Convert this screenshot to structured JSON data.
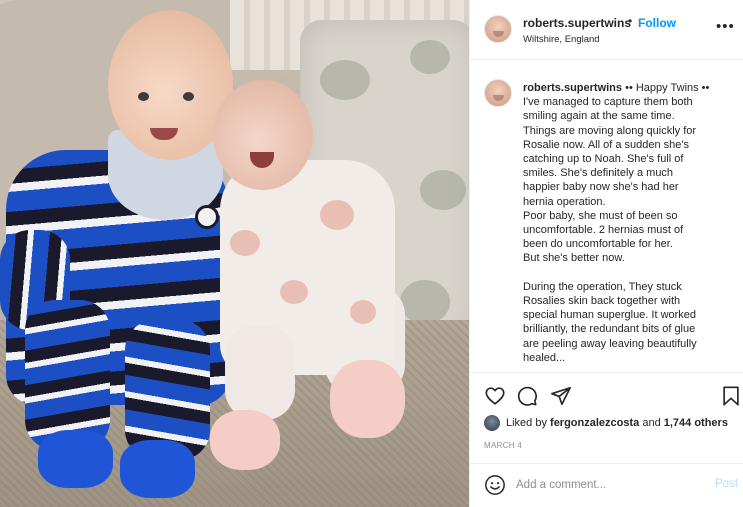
{
  "post": {
    "username": "roberts.supertwins",
    "separator": "•",
    "follow_label": "Follow",
    "location": "Wiltshire, England",
    "more_icon": "more-options-icon"
  },
  "caption": {
    "username": "roberts.supertwins",
    "lines": [
      "•• Happy Twins ••",
      "I've managed to capture them both",
      "smiling again at the same time.",
      "Things are moving along quickly for",
      "Rosalie now. All of a sudden she's",
      "catching up to Noah. She's full of",
      "smiles. She's definitely a much",
      "happier baby now she's had her",
      "hernia operation.",
      "Poor baby, she must of been so",
      "uncomfortable. 2 hernias must of",
      "been do uncomfortable for her.",
      "But she's better now.",
      "",
      "During the operation, They stuck",
      "Rosalies skin back together with",
      "special human superglue. It worked",
      "brilliantly, the redundant bits of glue",
      "are peeling away leaving beautifully",
      "healed..."
    ]
  },
  "actions": {
    "like_icon": "heart-icon",
    "comment_icon": "comment-icon",
    "share_icon": "share-icon",
    "save_icon": "bookmark-icon"
  },
  "likes": {
    "prefix": "Liked by ",
    "user": "fergonzalezcosta",
    "middle": " and ",
    "count": "1,744 others"
  },
  "date": "MARCH 4",
  "comment_box": {
    "placeholder": "Add a comment...",
    "post_label": "Post",
    "post_color": "#b3dbff"
  },
  "colors": {
    "follow": "#0095f6",
    "text": "#262626",
    "muted": "#8e8e8e"
  }
}
